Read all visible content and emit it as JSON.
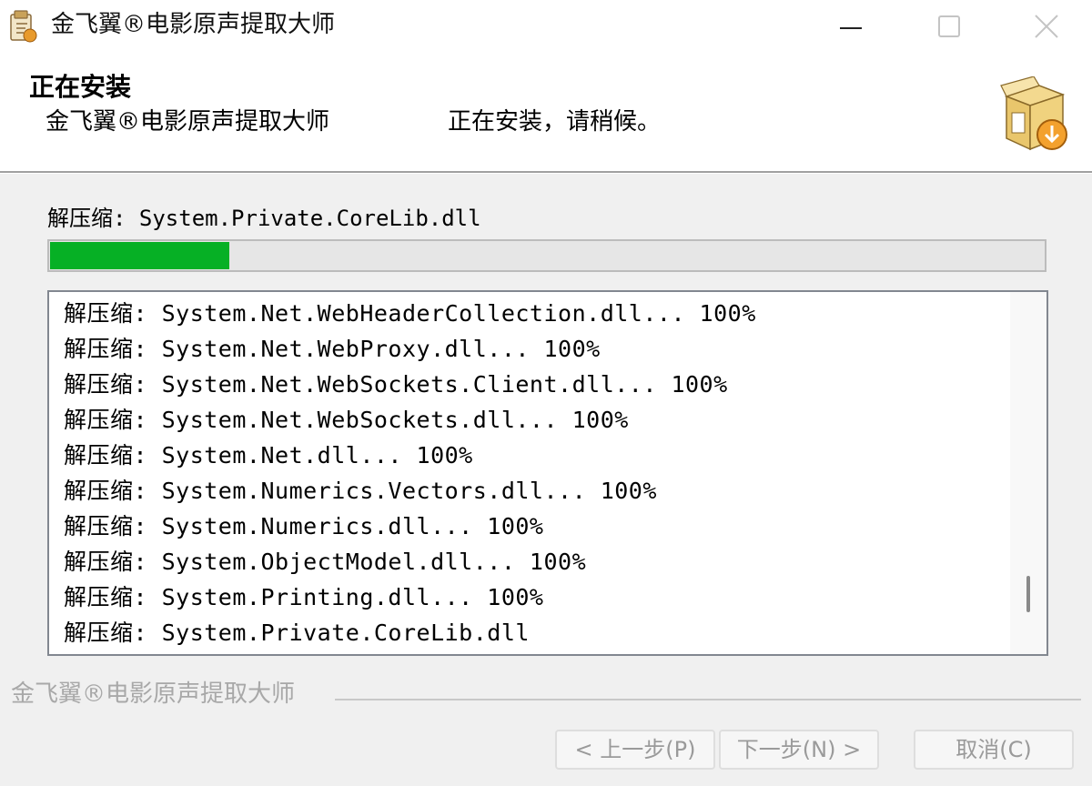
{
  "window": {
    "title": "金飞翼®电影原声提取大师",
    "minimize_icon": "minimize-icon",
    "maximize_icon": "maximize-icon",
    "close_icon": "close-icon"
  },
  "header": {
    "title": "正在安装",
    "app_name": "金飞翼®电影原声提取大师",
    "status": "正在安装，请稍候。"
  },
  "current": {
    "label": "解压缩: System.Private.CoreLib.dll"
  },
  "progress": {
    "value_percent": 18,
    "color": "#06b025"
  },
  "log": {
    "lines": [
      "解压缩: System.Net.WebHeaderCollection.dll... 100%",
      "解压缩: System.Net.WebProxy.dll... 100%",
      "解压缩: System.Net.WebSockets.Client.dll... 100%",
      "解压缩: System.Net.WebSockets.dll... 100%",
      "解压缩: System.Net.dll... 100%",
      "解压缩: System.Numerics.Vectors.dll... 100%",
      "解压缩: System.Numerics.dll... 100%",
      "解压缩: System.ObjectModel.dll... 100%",
      "解压缩: System.Printing.dll... 100%",
      "解压缩: System.Private.CoreLib.dll"
    ]
  },
  "footer": {
    "brand": "金飞翼®电影原声提取大师",
    "back_label": "< 上一步(P)",
    "next_label": "下一步(N) >",
    "cancel_label": "取消(C)"
  }
}
